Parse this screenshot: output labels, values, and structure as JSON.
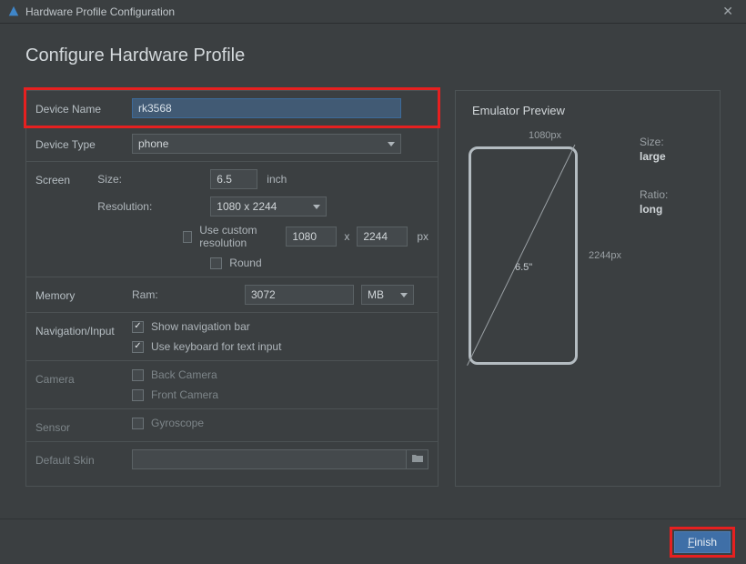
{
  "window": {
    "title": "Hardware Profile Configuration"
  },
  "page": {
    "heading": "Configure Hardware Profile"
  },
  "labels": {
    "deviceName": "Device Name",
    "deviceType": "Device Type",
    "screen": "Screen",
    "memory": "Memory",
    "navInput": "Navigation/Input",
    "camera": "Camera",
    "sensor": "Sensor",
    "defaultSkin": "Default Skin"
  },
  "fields": {
    "deviceName": "rk3568",
    "deviceType": "phone",
    "screen": {
      "sizeLabel": "Size:",
      "sizeValue": "6.5",
      "sizeUnit": "inch",
      "resolutionLabel": "Resolution:",
      "resolutionPreset": "1080 x 2244",
      "resCustomLabel": "Use custom resolution",
      "resW": "1080",
      "resH": "2244",
      "resUnit": "px",
      "roundLabel": "Round"
    },
    "memory": {
      "ramLabel": "Ram:",
      "ramValue": "3072",
      "ramUnit": "MB"
    },
    "navInput": {
      "showNavLabel": "Show navigation bar",
      "showNavChecked": true,
      "keyboardLabel": "Use keyboard for text input",
      "keyboardChecked": true
    },
    "camera": {
      "backLabel": "Back Camera",
      "backChecked": false,
      "frontLabel": "Front Camera",
      "frontChecked": false
    },
    "sensor": {
      "gyroLabel": "Gyroscope",
      "gyroChecked": false
    },
    "defaultSkin": ""
  },
  "preview": {
    "title": "Emulator Preview",
    "widthLabel": "1080px",
    "heightLabel": "2244px",
    "diagonal": "6.5\"",
    "sizeKey": "Size:",
    "sizeVal": "large",
    "ratioKey": "Ratio:",
    "ratioVal": "long"
  },
  "footer": {
    "finish": "Finish"
  }
}
